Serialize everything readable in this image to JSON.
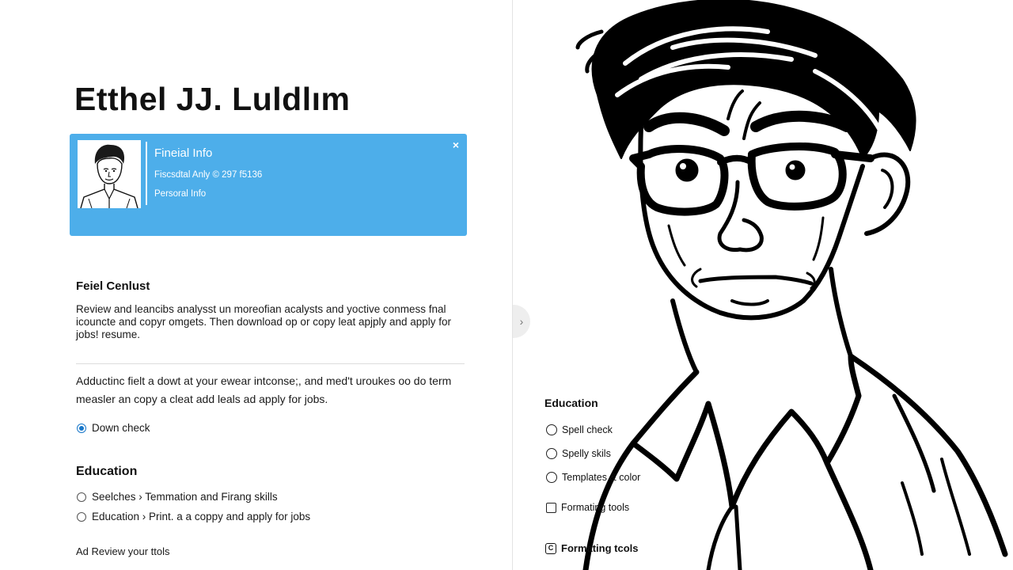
{
  "profile": {
    "name": "Etthel JJ. Luldlım"
  },
  "info_card": {
    "title": "Fineial Info",
    "line1": "Fiscsdtal Anly © 297 f5136",
    "line2": "Persoral Info",
    "close_icon": "×",
    "accent_color": "#4daeea"
  },
  "checklist": {
    "heading": "Feiel Cenlust",
    "paragraph": "Review and leancibs analysst un moreofian acalysts and yoctive conmess fnal icouncte and copyr omgets. Then download op or copy leat apjply and apply for jobs!                    resume.",
    "paragraph2": "Adductinc fielt a dowt at your ewear intconse;, and med't uroukes oo do term measler an copy a cleat add leals ad apply for jobs.",
    "radio_label": "Down check",
    "accent_color": "#1877c9"
  },
  "education": {
    "heading": "Education",
    "items": [
      "Seelches › Temmation and Firang skills",
      "Education › Print. a a coppy and apply for jobs"
    ]
  },
  "footer": {
    "text": "Ad Review your ttols"
  },
  "collapse": {
    "icon": "›"
  },
  "right_panel": {
    "heading": "Education",
    "options": [
      "Spell check",
      "Spelly skils",
      "Templates & color",
      "Formating tools",
      "Formating tcols"
    ],
    "format_icon_glyph": "C"
  }
}
